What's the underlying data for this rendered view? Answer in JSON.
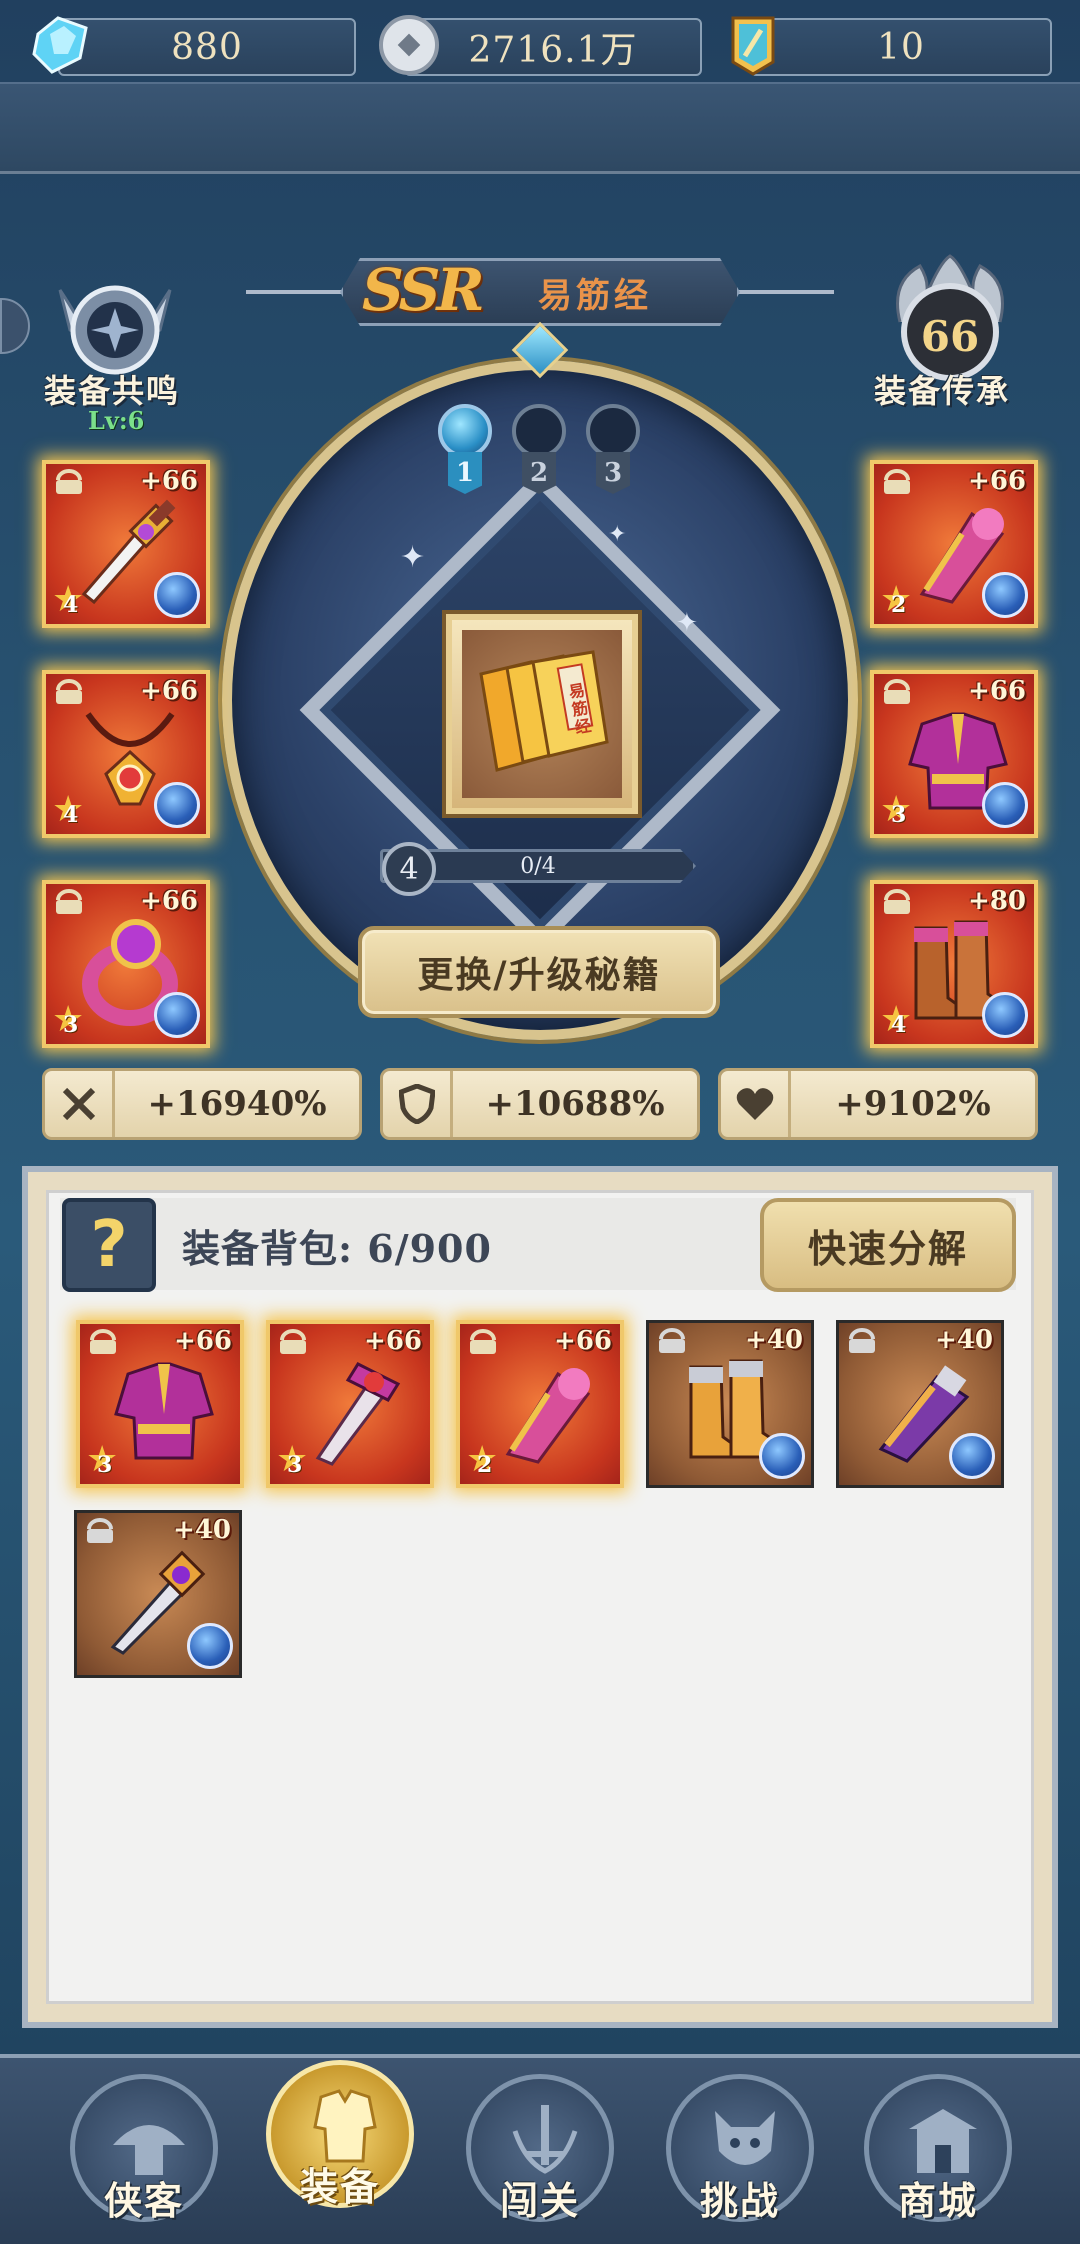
{
  "currency": {
    "gems": "880",
    "coins": "2716.1万",
    "tickets": "10"
  },
  "banner": {
    "rarity": "SSR",
    "name": "易筋经"
  },
  "left_medal": {
    "label": "装备共鸣",
    "level": "Lv:6"
  },
  "right_medal": {
    "label": "装备传承",
    "value": "66"
  },
  "slots": [
    {
      "num": "1",
      "active": true
    },
    {
      "num": "2",
      "active": false
    },
    {
      "num": "3",
      "active": false
    }
  ],
  "book": {
    "title": "易筋经",
    "level": "4",
    "progress": "0/4"
  },
  "upgrade_button": "更换/升级秘籍",
  "equipped": [
    {
      "side": "left",
      "item": "sword",
      "plus": "+66",
      "stars": "4"
    },
    {
      "side": "left",
      "item": "necklace",
      "plus": "+66",
      "stars": "4"
    },
    {
      "side": "left",
      "item": "ring",
      "plus": "+66",
      "stars": "3"
    },
    {
      "side": "right",
      "item": "bracer",
      "plus": "+66",
      "stars": "2"
    },
    {
      "side": "right",
      "item": "robe",
      "plus": "+66",
      "stars": "3"
    },
    {
      "side": "right",
      "item": "boots",
      "plus": "+80",
      "stars": "4"
    }
  ],
  "stats": {
    "attack": "+16940%",
    "defense": "+10688%",
    "health": "+9102%"
  },
  "bag": {
    "label": "装备背包: 6/900",
    "quick_button": "快速分解",
    "help": "?",
    "items": [
      {
        "item": "robe",
        "plus": "+66",
        "stars": "3",
        "rare": true
      },
      {
        "item": "sword",
        "plus": "+66",
        "stars": "3",
        "rare": true
      },
      {
        "item": "bracer",
        "plus": "+66",
        "stars": "2",
        "rare": true
      },
      {
        "item": "boots",
        "plus": "+40",
        "stars": "",
        "rare": false
      },
      {
        "item": "bracer",
        "plus": "+40",
        "stars": "",
        "rare": false
      },
      {
        "item": "sword",
        "plus": "+40",
        "stars": "",
        "rare": false
      }
    ]
  },
  "nav": [
    {
      "label": "侠客",
      "active": false
    },
    {
      "label": "装备",
      "active": true
    },
    {
      "label": "闯关",
      "active": false
    },
    {
      "label": "挑战",
      "active": false
    },
    {
      "label": "商城",
      "active": false
    }
  ],
  "colors": {
    "accent_gold": "#f0c86a",
    "rare_card": "#c8361e",
    "level_green": "#7be08a"
  }
}
